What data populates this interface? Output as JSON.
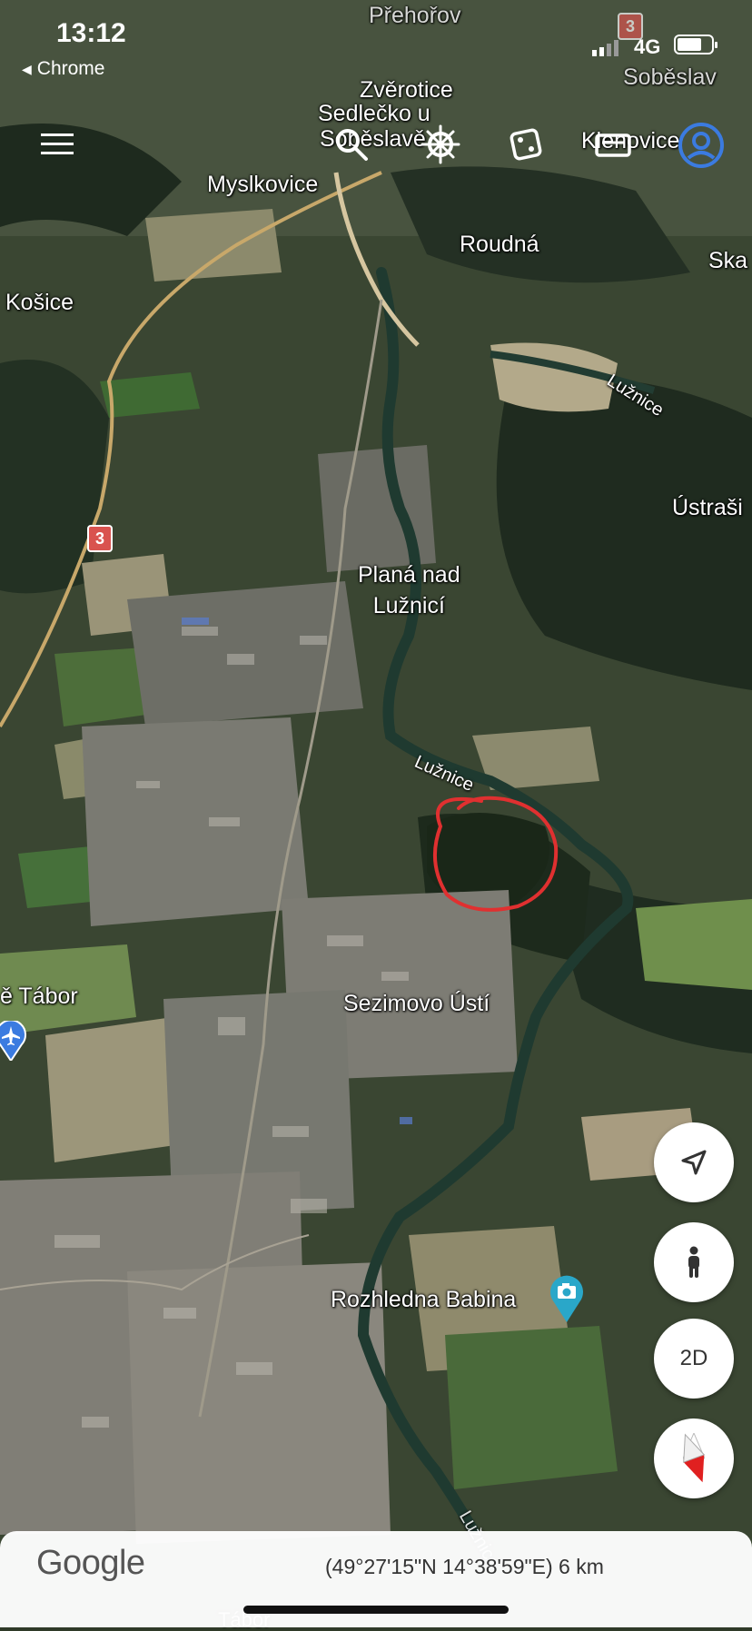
{
  "status_bar": {
    "time": "13:12",
    "back_app": "Chrome",
    "network": "4G"
  },
  "map_labels": {
    "prehorov": "Přehořov",
    "sobeslav": "Soběslav",
    "zverotice": "Zvěrotice",
    "sedlecko_line1": "Sedlečko u",
    "sedlecko_line2": "Soběslavě",
    "klenovice": "Klenovice",
    "myslkovice": "Myslkovice",
    "roudna": "Roudná",
    "ska": "Ska",
    "kosice": "Košice",
    "ustrasi": "Ústraši",
    "plana_line1": "Planá nad",
    "plana_line2": "Lužnicí",
    "luznice": "Lužnice",
    "tabor": "ě Tábor",
    "sezimovo": "Sezimovo Ústí",
    "rozhledna": "Rozhledna Babina",
    "tabor_bottom": "Tábor"
  },
  "road_shield": "3",
  "route_shield_top": "3",
  "buttons": {
    "mode_2d": "2D"
  },
  "bottom": {
    "logo": "Google",
    "coordinates": "(49°27'15\"N 14°38'59\"E) 6 km"
  },
  "colors": {
    "annotation_circle": "#e03030",
    "account_icon": "#3b7be0",
    "road_shield": "#d9534f",
    "river": "#1f3a30",
    "compass_red": "#e02020"
  }
}
